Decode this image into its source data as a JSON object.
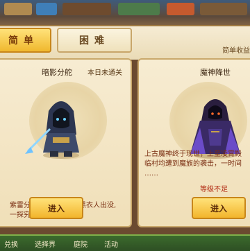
{
  "tabs": [
    {
      "label": "简单",
      "active": true
    },
    {
      "label": "困难",
      "active": false
    }
  ],
  "reward_label": "简单收益",
  "stages": [
    {
      "name": "暗影分舵",
      "status": "本日未通关",
      "description_lines": [
        "紫雷分舵基地附近又有黑衣人出没,",
        "一探究竟。"
      ],
      "enter_label": "进入"
    },
    {
      "name": "魔神降世",
      "description_lines": [
        "上古魔神终于现世，上至凌霄殿",
        "临村均遭到魔族的袭击，一时间",
        "……"
      ],
      "level_warning": "等级不足",
      "enter_label": "进入"
    }
  ],
  "bottom_bar": [
    "兑换",
    "选择界",
    "庭院",
    "活动"
  ],
  "colors": {
    "tab_active": "#f0b82e",
    "panel_bg": "#f7ecd2",
    "description_text": "#7a2e12",
    "warning_text": "#b22a12"
  }
}
